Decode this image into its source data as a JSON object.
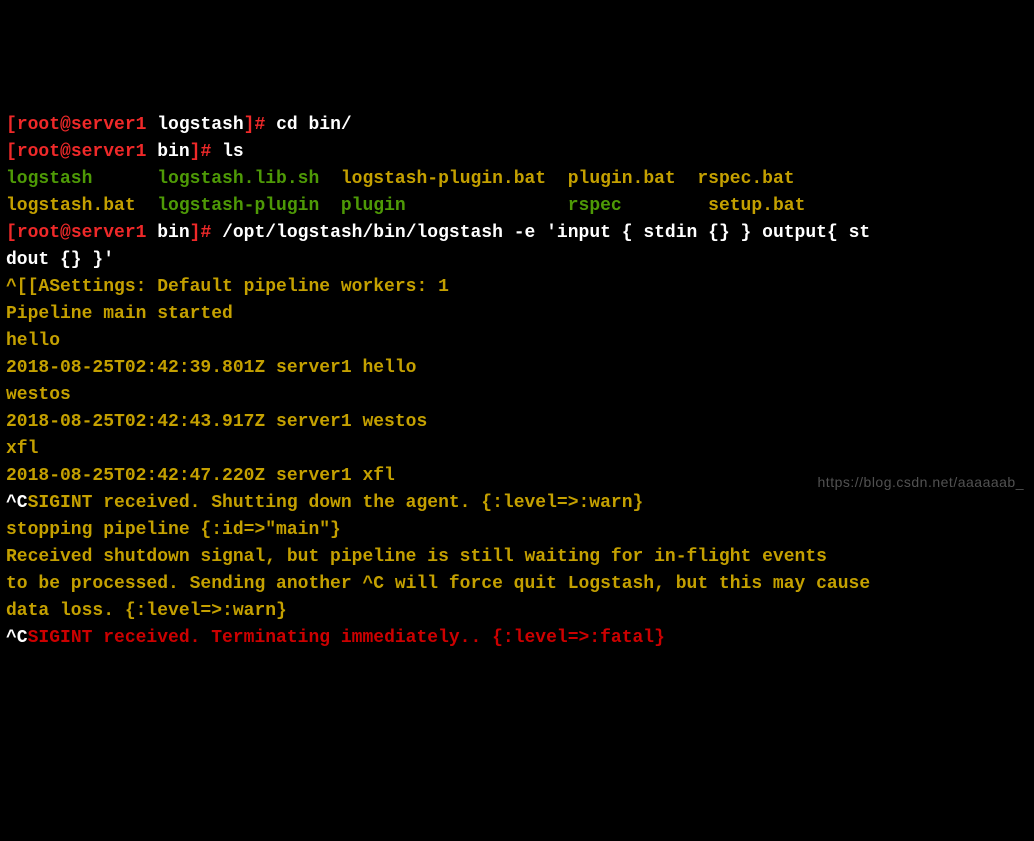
{
  "l1": {
    "prompt_a": "[",
    "user": "root@server1",
    "sep": " ",
    "dir": "logstash",
    "prompt_b": "]# ",
    "cmd": "cd bin/"
  },
  "l2": {
    "prompt_a": "[",
    "user": "root@server1",
    "sep": " ",
    "dir": "bin",
    "prompt_b": "]# ",
    "cmd": "ls"
  },
  "ls": {
    "c1r1": "logstash",
    "c1r2": "logstash.bat",
    "c2r1": "logstash.lib.sh",
    "c2r2": "logstash-plugin",
    "c3r1": "logstash-plugin.bat",
    "c3r2": "plugin",
    "c4r1": "plugin.bat",
    "c4r2": "rspec",
    "c5r1": "rspec.bat",
    "c5r2": "setup.bat",
    "sp1_1": "      ",
    "sp1_2": "  ",
    "sp2_1": "  ",
    "sp2_2": "  ",
    "sp3_1": "  ",
    "sp3_2": "               ",
    "sp4_1": "  ",
    "sp4_2": "        ",
    "sp5_1": "  ",
    "sp5_2": "  "
  },
  "l3": {
    "prompt_a": "[",
    "user": "root@server1",
    "sep": " ",
    "dir": "bin",
    "prompt_b": "]# ",
    "cmd_a": "/opt/logstash/bin/logstash -e 'input { stdin {} } output{ st",
    "cmd_b": "dout {} }'"
  },
  "out": {
    "settings": "^[[ASettings: Default pipeline workers: 1",
    "started": "Pipeline main started",
    "in1": "hello",
    "ts1": "2018-08-25T02:42:39.801Z server1 hello",
    "in2": "westos",
    "ts2": "2018-08-25T02:42:43.917Z server1 westos",
    "in3": "xfl",
    "ts3": "2018-08-25T02:42:47.220Z server1 xfl",
    "sig1_c": "^C",
    "sig1_t": "SIGINT received. Shutting down the agent. {:level=>:warn}",
    "stop": "stopping pipeline {:id=>\"main\"}",
    "recv1": "Received shutdown signal, but pipeline is still waiting for in-flight events",
    "recv2": "to be processed. Sending another ^C will force quit Logstash, but this may cause",
    "recv3": "data loss. {:level=>:warn}",
    "sig2_c": "^C",
    "sig2_t": "SIGINT received. Terminating immediately.. {:level=>:fatal}"
  },
  "watermark": "https://blog.csdn.net/aaaaaab_"
}
